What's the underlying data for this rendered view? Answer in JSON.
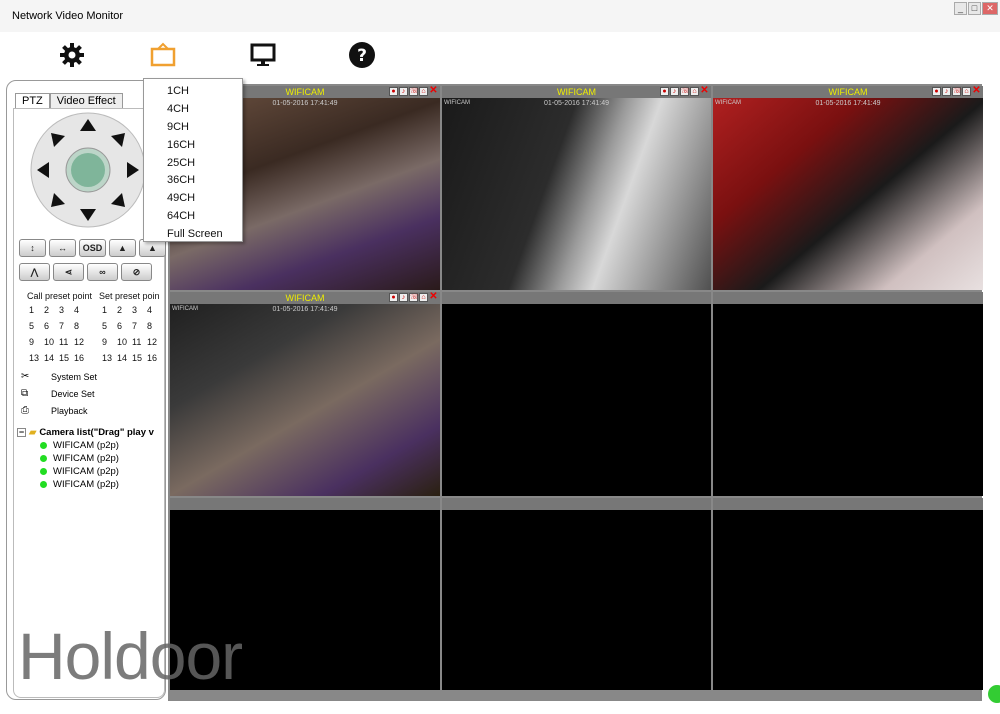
{
  "window": {
    "title": "Network Video Monitor",
    "min": "_",
    "max": "□",
    "close": "✕"
  },
  "toolbar": {
    "icons": [
      "gear-icon",
      "layout-icon",
      "monitor-icon",
      "help-icon"
    ],
    "accent": "#f0a030"
  },
  "channel_menu": {
    "items": [
      "1CH",
      "4CH",
      "9CH",
      "16CH",
      "25CH",
      "36CH",
      "49CH",
      "64CH",
      "Full Screen"
    ]
  },
  "tabs": {
    "ptz": "PTZ",
    "video_effect": "Video Effect"
  },
  "ptz": {
    "row1": [
      "↕",
      "↔",
      "OSD",
      "▲",
      "▲"
    ],
    "row2": [
      "⋀",
      "⋖",
      "∞",
      "⊘"
    ]
  },
  "presets": {
    "call_label": "Call preset point",
    "set_label": "Set preset poin",
    "call": [
      "1",
      "2",
      "3",
      "4",
      "5",
      "6",
      "7",
      "8",
      "9",
      "10",
      "11",
      "12",
      "13",
      "14",
      "15",
      "16"
    ],
    "set": [
      "1",
      "2",
      "3",
      "4",
      "5",
      "6",
      "7",
      "8",
      "9",
      "10",
      "11",
      "12",
      "13",
      "14",
      "15",
      "16"
    ]
  },
  "links": {
    "system_set": "System Set",
    "device_set": "Device Set",
    "playback": "Playback"
  },
  "camera_list": {
    "root": "Camera list(\"Drag\" play v",
    "items": [
      "WIFICAM (p2p)",
      "WIFICAM (p2p)",
      "WIFICAM (p2p)",
      "WIFICAM (p2p)"
    ]
  },
  "cells": [
    {
      "title": "WIFICAM",
      "stamp": "01-05-2016 17:41:49",
      "active": true
    },
    {
      "title": "WIFICAM",
      "stamp": "01-05-2016 17:41:49",
      "active": true
    },
    {
      "title": "WIFICAM",
      "stamp": "01-05-2016 17:41:49",
      "active": true
    },
    {
      "title": "WIFICAM",
      "stamp": "01-05-2016 17:41:49",
      "active": true
    },
    {
      "title": "",
      "active": false
    },
    {
      "title": "",
      "active": false
    },
    {
      "title": "",
      "active": false
    },
    {
      "title": "",
      "active": false
    },
    {
      "title": "",
      "active": false
    }
  ],
  "cam_label": "WIFICAM",
  "watermark": "Holdoor"
}
